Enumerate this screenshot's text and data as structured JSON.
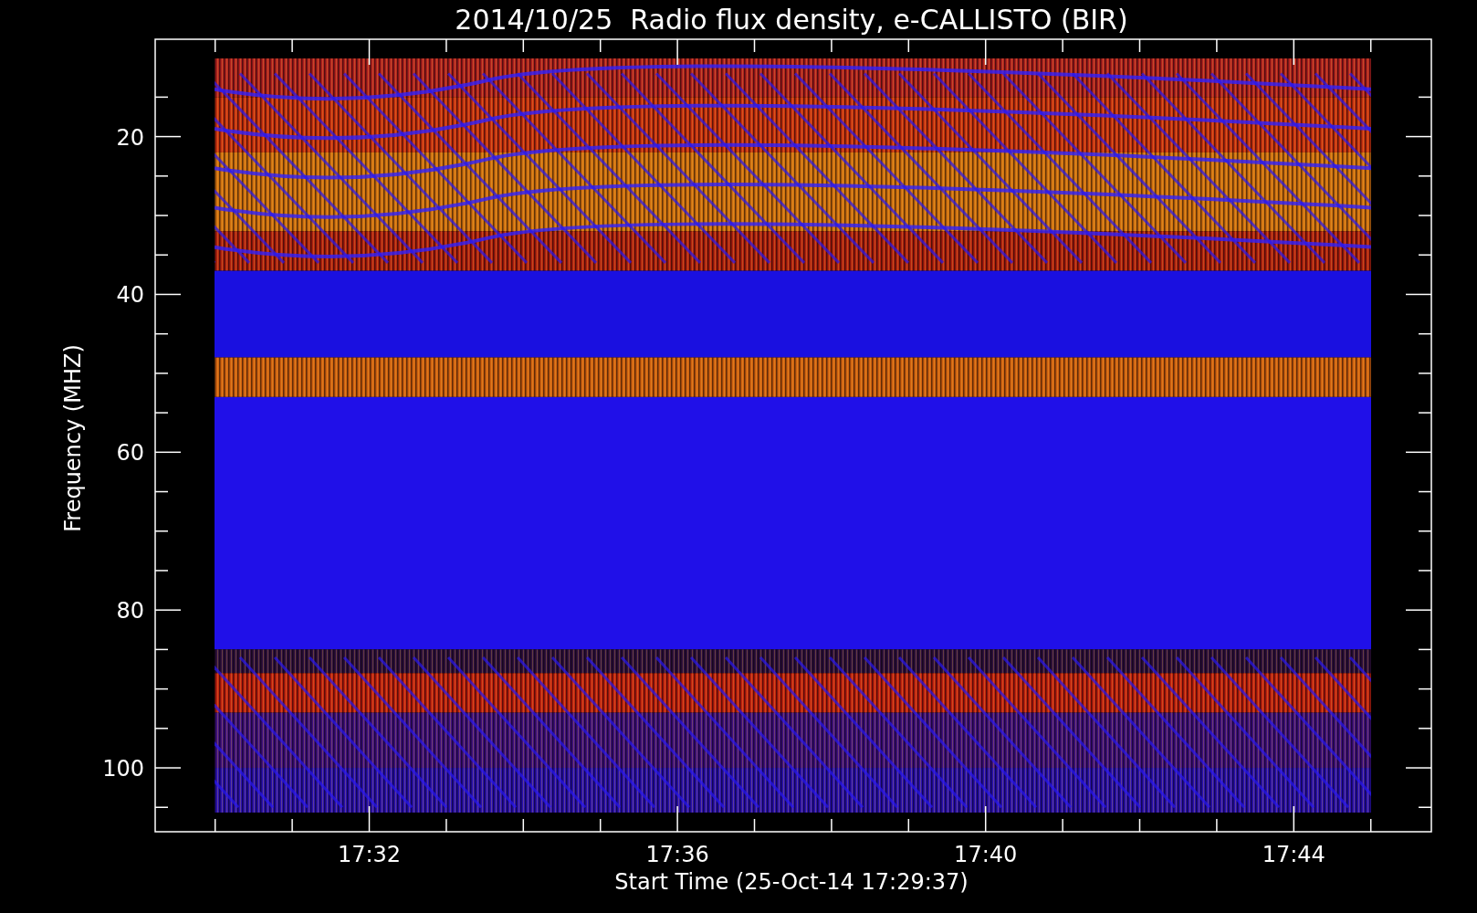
{
  "title": "2014/10/25  Radio flux density, e-CALLISTO (BIR)",
  "y_axis": {
    "label": "Frequency (MHZ)",
    "ticks": [
      "20",
      "40",
      "60",
      "80",
      "100"
    ]
  },
  "x_axis": {
    "label": "Start Time (25-Oct-14 17:29:37)",
    "ticks": [
      "17:32",
      "17:36",
      "17:40",
      "17:44"
    ]
  }
}
